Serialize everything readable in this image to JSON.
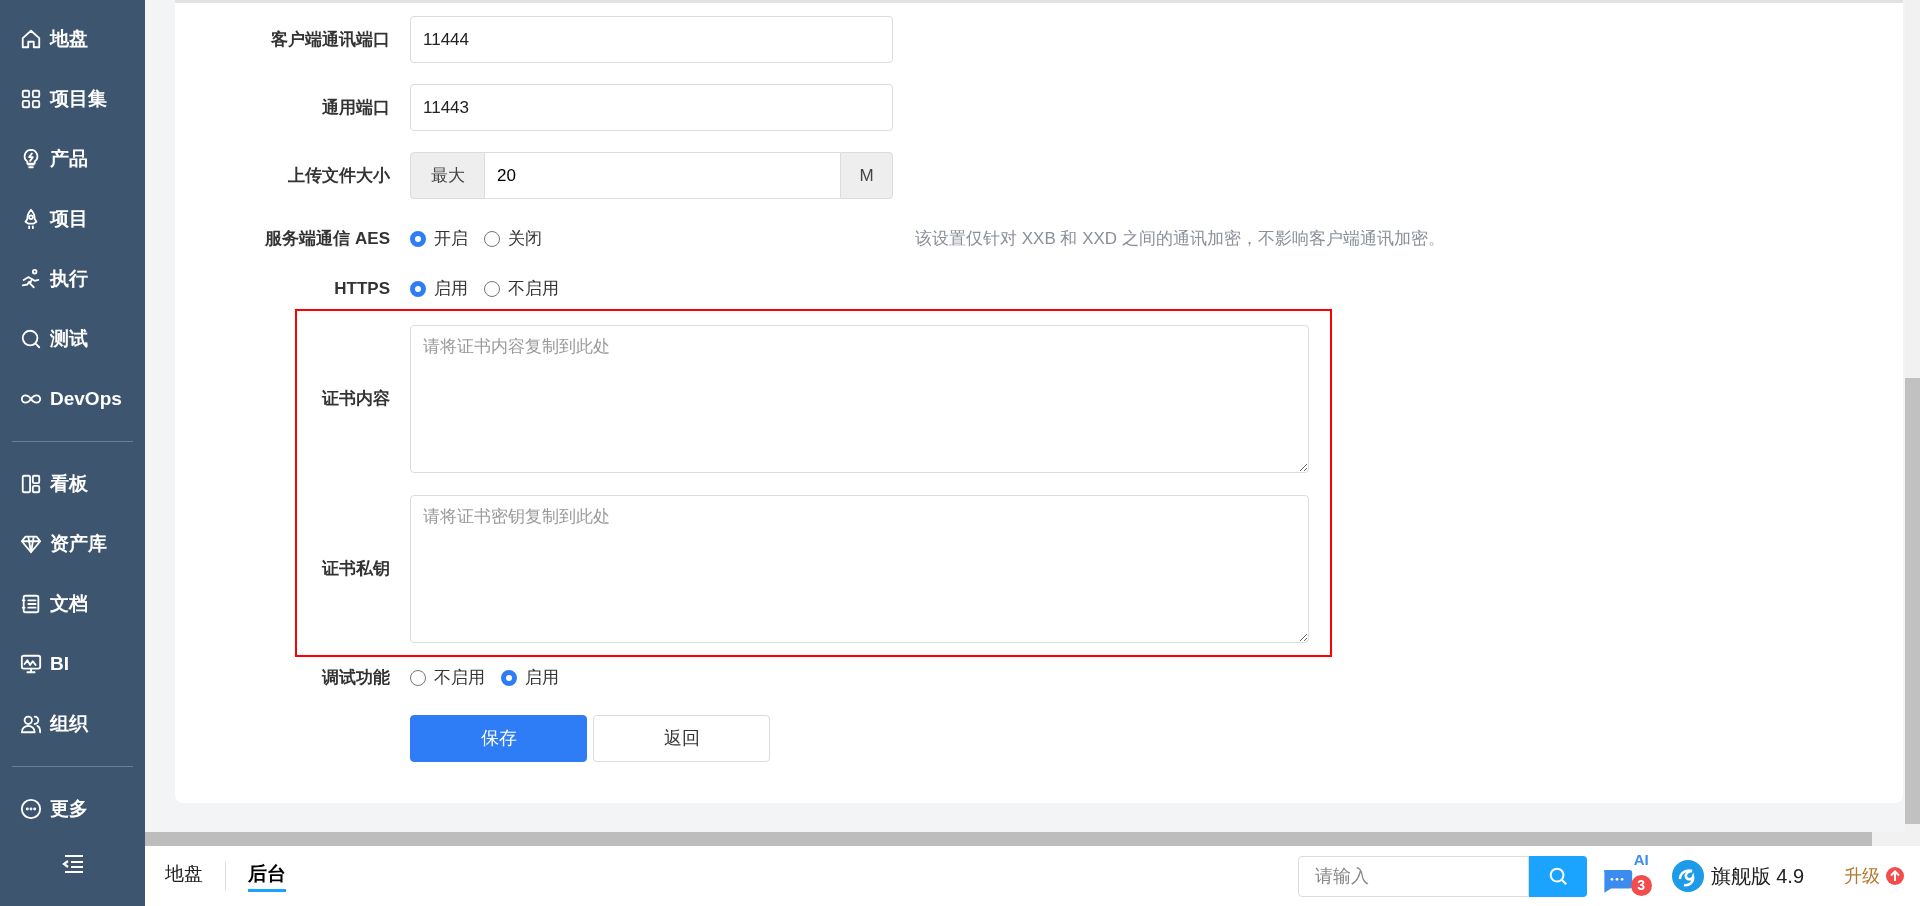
{
  "sidebar": {
    "groups": [
      [
        {
          "label": "地盘"
        },
        {
          "label": "项目集"
        },
        {
          "label": "产品"
        },
        {
          "label": "项目"
        },
        {
          "label": "执行"
        },
        {
          "label": "测试"
        },
        {
          "label": "DevOps"
        }
      ],
      [
        {
          "label": "看板"
        },
        {
          "label": "资产库"
        },
        {
          "label": "文档"
        },
        {
          "label": "BI"
        },
        {
          "label": "组织"
        }
      ],
      [
        {
          "label": "更多"
        }
      ]
    ]
  },
  "form": {
    "rows": [
      {
        "kind": "input",
        "label": "客户端通讯端口",
        "value": "11444"
      },
      {
        "kind": "input",
        "label": "通用端口",
        "value": "11443"
      },
      {
        "kind": "addon",
        "label": "上传文件大小",
        "prefix": "最大",
        "value": "20",
        "suffix": "M"
      },
      {
        "kind": "radio",
        "label": "服务端通信 AES",
        "options": [
          {
            "label": "开启",
            "selected": true
          },
          {
            "label": "关闭",
            "selected": false
          }
        ],
        "hint": "该设置仅针对 XXB 和 XXD 之间的通讯加密，不影响客户端通讯加密。"
      },
      {
        "kind": "radio",
        "label": "HTTPS",
        "options": [
          {
            "label": "启用",
            "selected": true
          },
          {
            "label": "不启用",
            "selected": false
          }
        ]
      },
      {
        "kind": "highlight",
        "children": [
          {
            "label": "证书内容",
            "placeholder": "请将证书内容复制到此处"
          },
          {
            "label": "证书私钥",
            "placeholder": "请将证书密钥复制到此处"
          }
        ]
      },
      {
        "kind": "radio",
        "label": "调试功能",
        "options": [
          {
            "label": "不启用",
            "selected": false
          },
          {
            "label": "启用",
            "selected": true
          }
        ]
      }
    ],
    "buttons": [
      {
        "kind": "primary",
        "label": "保存"
      },
      {
        "kind": "default",
        "label": "返回"
      }
    ]
  },
  "footer": {
    "tabs": [
      {
        "label": "地盘",
        "selected": false
      },
      {
        "label": "后台",
        "selected": true
      }
    ],
    "search": {
      "placeholder": "请输入"
    },
    "ai": {
      "label": "AI",
      "badge": "3"
    },
    "edition": "旗舰版 4.9",
    "upgrade": "升级"
  }
}
